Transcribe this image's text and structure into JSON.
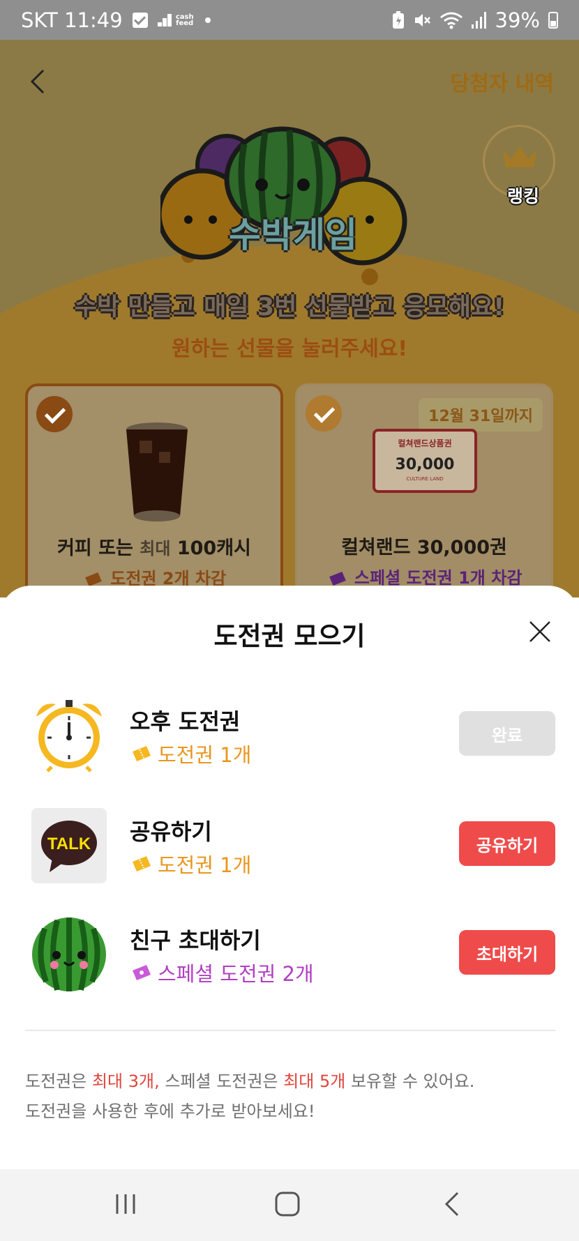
{
  "status_bar": {
    "carrier_time": "SKT 11:49",
    "cashfeed_label": "cash feed",
    "battery": "39%"
  },
  "header": {
    "winners_link": "당첨자 내역",
    "ranking_label": "랭킹"
  },
  "game": {
    "logo_title": "수박게임",
    "headline": "수박 만들고 매일 3번 선물받고 응모해요!",
    "subhead": "원하는 선물을 눌러주세요!"
  },
  "prizes": [
    {
      "name_main": "커피 또는 ",
      "name_dim": "최대",
      "name_tail": " 100캐시",
      "cost": "도전권 2개 차감",
      "selected": true
    },
    {
      "deadline": "12월 31일까지",
      "name": "컬쳐랜드 30,000권",
      "cost": "스페셜 도전권 1개 차감",
      "giftcard_title": "컬쳐랜드상품권",
      "giftcard_amount": "30,000",
      "giftcard_foot": "CULTURE LAND",
      "selected": true
    }
  ],
  "sheet": {
    "title": "도전권 모으기",
    "tasks": [
      {
        "title": "오후 도전권",
        "reward": "도전권 1개",
        "button": "완료",
        "icon": "alarm-clock-icon"
      },
      {
        "title": "공유하기",
        "reward": "도전권 1개",
        "button": "공유하기",
        "icon": "kakao-talk-icon",
        "icon_text": "TALK"
      },
      {
        "title": "친구 초대하기",
        "reward": "스페셜 도전권 2개",
        "button": "초대하기",
        "icon": "watermelon-icon"
      }
    ],
    "notice": {
      "p1": "도전권은 ",
      "p1_hl": "최대 3개,",
      "p2": " 스페셜 도전권은 ",
      "p2_hl": "최대 5개",
      "p3": " 보유할 수 있어요.",
      "line2": "도전권을 사용한 후에 추가로 받아보세요!"
    }
  },
  "colors": {
    "accent_red": "#ef4b4b",
    "reward_orange": "#e8971e",
    "special_purple": "#b13fc3",
    "done_gray": "#e0e0e0"
  }
}
